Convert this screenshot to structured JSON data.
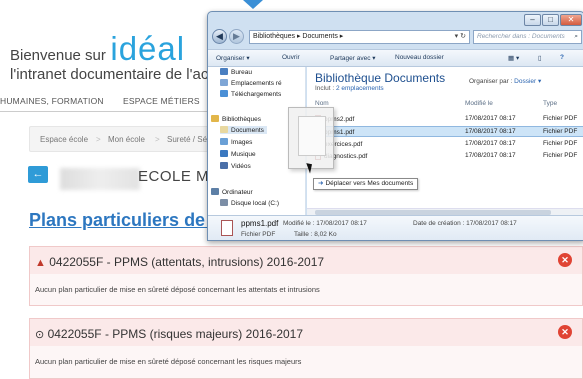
{
  "page": {
    "welcome_line1": "Bienvenue sur",
    "logo": "idéal",
    "welcome_line2": "l'intranet documentaire de l'ac",
    "nav": [
      "HUMAINES, FORMATION",
      "ESPACE MÉTIERS"
    ],
    "breadcrumb": [
      "Espace école",
      ">",
      "Mon école",
      ">",
      "Sureté / Séc"
    ],
    "school_name": "ECOLE MAT",
    "plans_title": "Plans particuliers de mi",
    "panels": [
      {
        "symbol": "▲",
        "title": "0422055F - PPMS (attentats, intrusions) 2016-2017",
        "body": "Aucun plan particulier de mise en sûreté déposé concernant les attentats et intrusions"
      },
      {
        "symbol": "⊙",
        "title": "0422055F - PPMS (risques majeurs) 2016-2017",
        "body": "Aucun plan particulier de mise en sûreté déposé concernant les risques majeurs"
      }
    ]
  },
  "explorer": {
    "address": "Bibliothèques ▸ Documents ▸",
    "search_placeholder": "Rechercher dans : Documents",
    "toolbar": [
      "Organiser ▾",
      "Ouvrir",
      "Partager avec ▾",
      "Nouveau dossier"
    ],
    "nav_items": [
      {
        "label": "Bureau",
        "color": "#4a7fc1"
      },
      {
        "label": "Emplacements ré",
        "color": "#7fa6d6"
      },
      {
        "label": "Téléchargements",
        "color": "#4a8fd6"
      },
      {
        "label": "Bibliothèques",
        "color": "#e2b64a"
      },
      {
        "label": "Documents",
        "color": "#e8d8a0"
      },
      {
        "label": "Images",
        "color": "#6aa0d6"
      },
      {
        "label": "Musique",
        "color": "#3a78c0"
      },
      {
        "label": "Vidéos",
        "color": "#4a6fa8"
      },
      {
        "label": "Ordinateur",
        "color": "#5d7fa6"
      },
      {
        "label": "Disque local (C:)",
        "color": "#7c8ea6"
      }
    ],
    "library_title": "Bibliothèque Documents",
    "library_sub_prefix": "Inclut :",
    "library_sub_link": "2 emplacements",
    "organize_label": "Organiser par :",
    "organize_value": "Dossier ▾",
    "columns": [
      "Nom",
      "Modifié le",
      "Type"
    ],
    "files": [
      {
        "name": "ppms2.pdf",
        "modified": "17/08/2017 08:17",
        "type": "Fichier PDF"
      },
      {
        "name": "ppms1.pdf",
        "modified": "17/08/2017 08:17",
        "type": "Fichier PDF"
      },
      {
        "name": "exercices.pdf",
        "modified": "17/08/2017 08:17",
        "type": "Fichier PDF"
      },
      {
        "name": "diagnostics.pdf",
        "modified": "17/08/2017 08:17",
        "type": "Fichier PDF"
      }
    ],
    "drag_tooltip": "Déplacer vers Mes documents",
    "details": {
      "filename": "ppms1.pdf",
      "modified": "Modifié le : 17/08/2017 08:17",
      "created": "Date de création : 17/08/2017 08:17",
      "type": "Fichier PDF",
      "size": "Taille : 8,02 Ko"
    }
  }
}
